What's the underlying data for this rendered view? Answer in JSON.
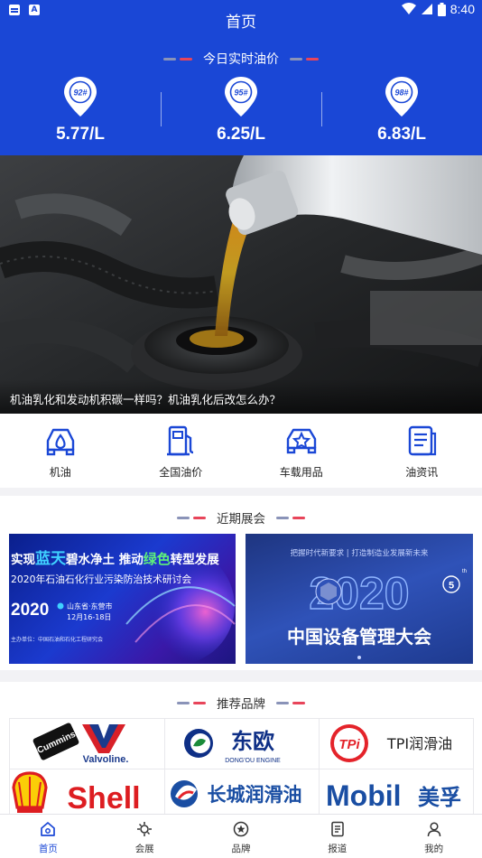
{
  "status_bar": {
    "time": "8:40"
  },
  "header": {
    "title": "首页",
    "price_title": "今日实时油价"
  },
  "prices": [
    {
      "grade": "92#",
      "price": "5.77/L"
    },
    {
      "grade": "95#",
      "price": "6.25/L"
    },
    {
      "grade": "98#",
      "price": "6.83/L"
    }
  ],
  "banner": {
    "caption": "机油乳化和发动机积碳一样吗？机油乳化后改怎么办？"
  },
  "categories": [
    {
      "label": "机油",
      "icon": "car-oil-icon"
    },
    {
      "label": "全国油价",
      "icon": "fuel-pump-icon"
    },
    {
      "label": "车载用品",
      "icon": "car-star-icon"
    },
    {
      "label": "油资讯",
      "icon": "news-doc-icon"
    }
  ],
  "exhibitions": {
    "title": "近期展会",
    "items": [
      {
        "headline_a": "实现",
        "headline_b": "蓝天",
        "headline_c": "碧水净土  推动",
        "headline_d": "绿色",
        "headline_e": "转型发展",
        "subtitle": "2020年石油石化行业污染防治技术研讨会",
        "year": "2020",
        "location": "山东省·东营市",
        "date": "12月16-18日",
        "organizer": "主办单位：中国石油和石化工程研究会"
      },
      {
        "slogan": "把握时代新要求 | 打造制造业发展新未来",
        "year": "2020",
        "edition": "5",
        "edition_suffix": "th",
        "name": "中国设备管理大会"
      }
    ]
  },
  "brands": {
    "title": "推荐品牌",
    "items": [
      {
        "name_a": "Cummins",
        "name_b": "Valvoline."
      },
      {
        "name": "东欧",
        "sub": "DONG'OU ENGINE"
      },
      {
        "badge": "TPi",
        "name": "TPI润滑油"
      },
      {
        "name": "Shell"
      },
      {
        "name": "长城润滑油"
      },
      {
        "name": "Mobil",
        "cn": "美孚"
      }
    ]
  },
  "bottom_nav": [
    {
      "label": "首页",
      "icon": "home-icon",
      "active": true
    },
    {
      "label": "会展",
      "icon": "exhibition-icon",
      "active": false
    },
    {
      "label": "品牌",
      "icon": "brand-icon",
      "active": false
    },
    {
      "label": "报道",
      "icon": "report-icon",
      "active": false
    },
    {
      "label": "我的",
      "icon": "user-icon",
      "active": false
    }
  ],
  "colors": {
    "primary": "#1a47d6",
    "accent_red": "#e8455a",
    "shell_red": "#dd1d21",
    "shell_yellow": "#fbce07",
    "mobil_blue": "#1a4ea3"
  }
}
